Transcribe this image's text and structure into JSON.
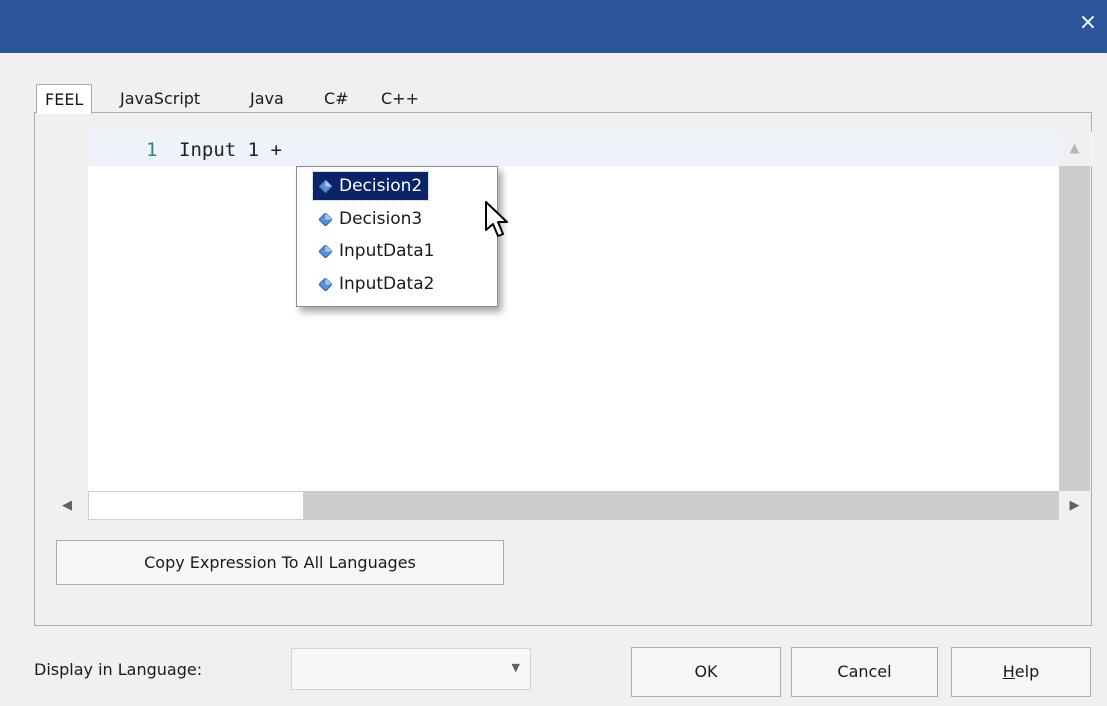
{
  "window": {
    "close_glyph": "×",
    "titlebar_color": "#2b579a"
  },
  "tabs": [
    {
      "label": "FEEL",
      "active": true
    },
    {
      "label": "JavaScript"
    },
    {
      "label": "Java"
    },
    {
      "label": "C#"
    },
    {
      "label": "C++"
    }
  ],
  "editor": {
    "line_number": "1",
    "code": "Input 1 +",
    "scroll_up_glyph": "▲",
    "scroll_left_glyph": "◀",
    "scroll_right_glyph": "▶"
  },
  "autocomplete": {
    "items": [
      {
        "label": "Decision2",
        "icon": "element-icon",
        "selected": true
      },
      {
        "label": "Decision3",
        "icon": "element-icon"
      },
      {
        "label": "InputData1",
        "icon": "element-icon"
      },
      {
        "label": "InputData2",
        "icon": "element-icon"
      }
    ],
    "selection_color": "#0a246a"
  },
  "copy_button": {
    "label": "Copy Expression To All Languages"
  },
  "display_language": {
    "label": "Display in Language:",
    "value": "",
    "caret_glyph": "▼"
  },
  "buttons": {
    "ok": "OK",
    "cancel": "Cancel",
    "help_underlined": "H",
    "help_rest": "elp"
  }
}
